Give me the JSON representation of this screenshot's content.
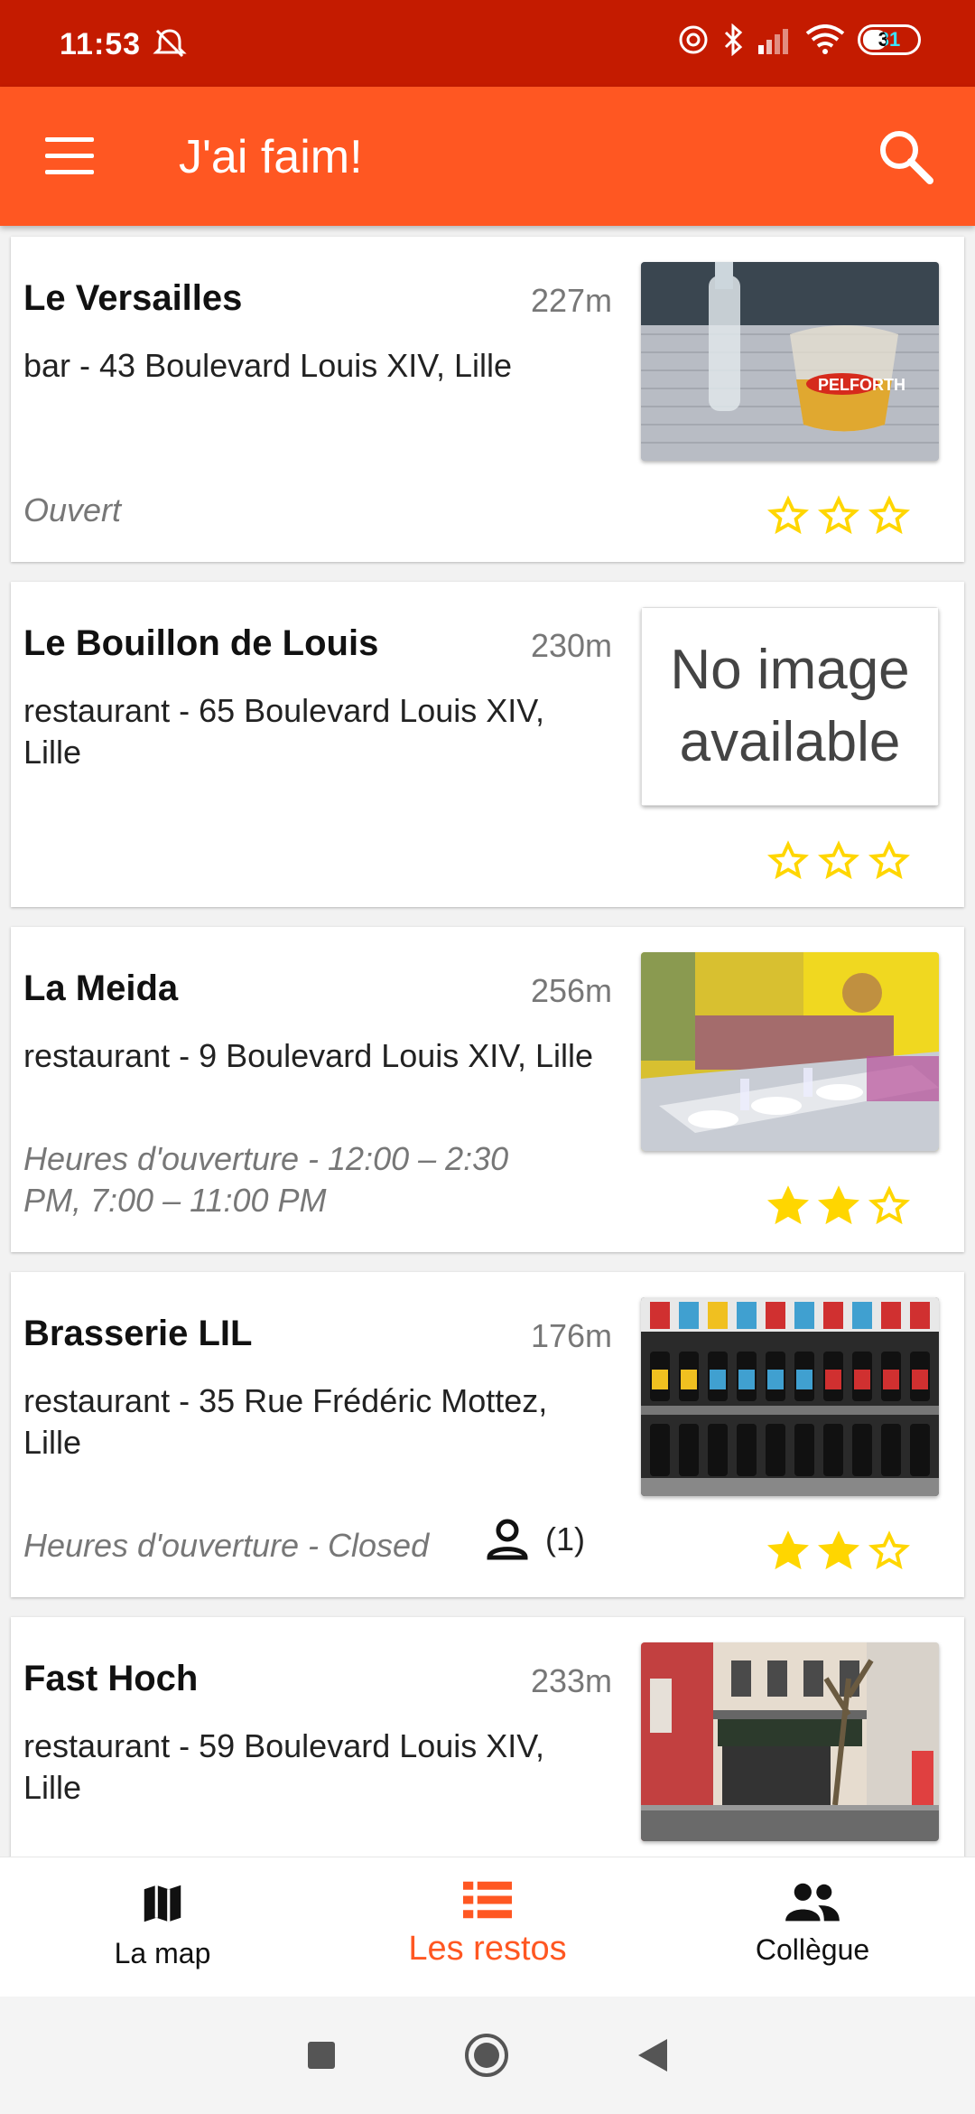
{
  "status_bar": {
    "time": "11:53",
    "battery": "31"
  },
  "app_bar": {
    "title": "J'ai faim!"
  },
  "restaurants": [
    {
      "name": "Le Versailles",
      "distance": "227m",
      "address": "bar - 43 Boulevard Louis XIV, Lille",
      "hours": "Ouvert",
      "rating": 0,
      "image": "photo"
    },
    {
      "name": "Le Bouillon de Louis",
      "distance": "230m",
      "address": "restaurant - 65 Boulevard Louis XIV, Lille",
      "hours": "",
      "rating": 0,
      "image": "none",
      "no_image_text": "No image available"
    },
    {
      "name": "La Meida",
      "distance": "256m",
      "address": "restaurant - 9 Boulevard Louis XIV, Lille",
      "hours": "Heures d'ouverture -  12:00 – 2:30 PM, 7:00 – 11:00 PM",
      "rating": 2,
      "image": "photo"
    },
    {
      "name": "Brasserie LIL",
      "distance": "176m",
      "address": "restaurant - 35 Rue Frédéric Mottez, Lille",
      "hours": "Heures d'ouverture -  Closed",
      "workmates": "(1)",
      "rating": 2,
      "image": "photo"
    },
    {
      "name": "Fast Hoch",
      "distance": "233m",
      "address": "restaurant - 59 Boulevard Louis XIV, Lille",
      "hours": "",
      "rating": 0,
      "image": "photo"
    }
  ],
  "bottom_nav": {
    "map": "La map",
    "restos": "Les restos",
    "colleague": "Collègue"
  },
  "colors": {
    "primary": "#ff5722",
    "status_bar": "#c41b00",
    "star": "#ffd600"
  }
}
